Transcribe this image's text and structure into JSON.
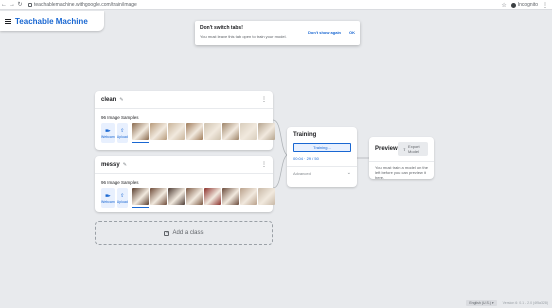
{
  "browser": {
    "url": "teachablemachine.withgoogle.com/train/image",
    "profile_label": "Incognito"
  },
  "header": {
    "logo": "Teachable Machine"
  },
  "toast": {
    "title": "Don't switch tabs!",
    "message": "You must leave this tab open to train your model.",
    "dismiss_label": "Don't show again",
    "ok_label": "OK"
  },
  "classes": [
    {
      "name": "clean",
      "samples_label": "96 Image Samples",
      "webcam_label": "Webcam",
      "upload_label": "Upload",
      "thumb_colors": [
        "#8a6a4e",
        "#b79a7a",
        "#c9b49a",
        "#a07c5a",
        "#cfc2ae",
        "#9e8468",
        "#d8cdbc",
        "#b5a48e"
      ]
    },
    {
      "name": "messy",
      "samples_label": "96 Image Samples",
      "webcam_label": "Webcam",
      "upload_label": "Upload",
      "thumb_colors": [
        "#5a3e2e",
        "#6e4b38",
        "#4d3b33",
        "#7c5944",
        "#8b2f2a",
        "#6a4a3a",
        "#b9a08a",
        "#c8b8a6"
      ]
    }
  ],
  "add_class_label": "Add a class",
  "training": {
    "title": "Training",
    "button_label": "Training...",
    "progress_text": "00:04 · 29 / 50",
    "advanced_label": "Advanced"
  },
  "preview": {
    "title": "Preview",
    "export_label": "Export Model",
    "message": "You must train a model on the left before you can preview it here."
  },
  "footer": {
    "language": "English (U.S.) ▾",
    "version": "Version 6: 0.1 - 2.0 (4f5a328)"
  },
  "colors": {
    "accent": "#1967d2",
    "background": "#e8eaed"
  }
}
